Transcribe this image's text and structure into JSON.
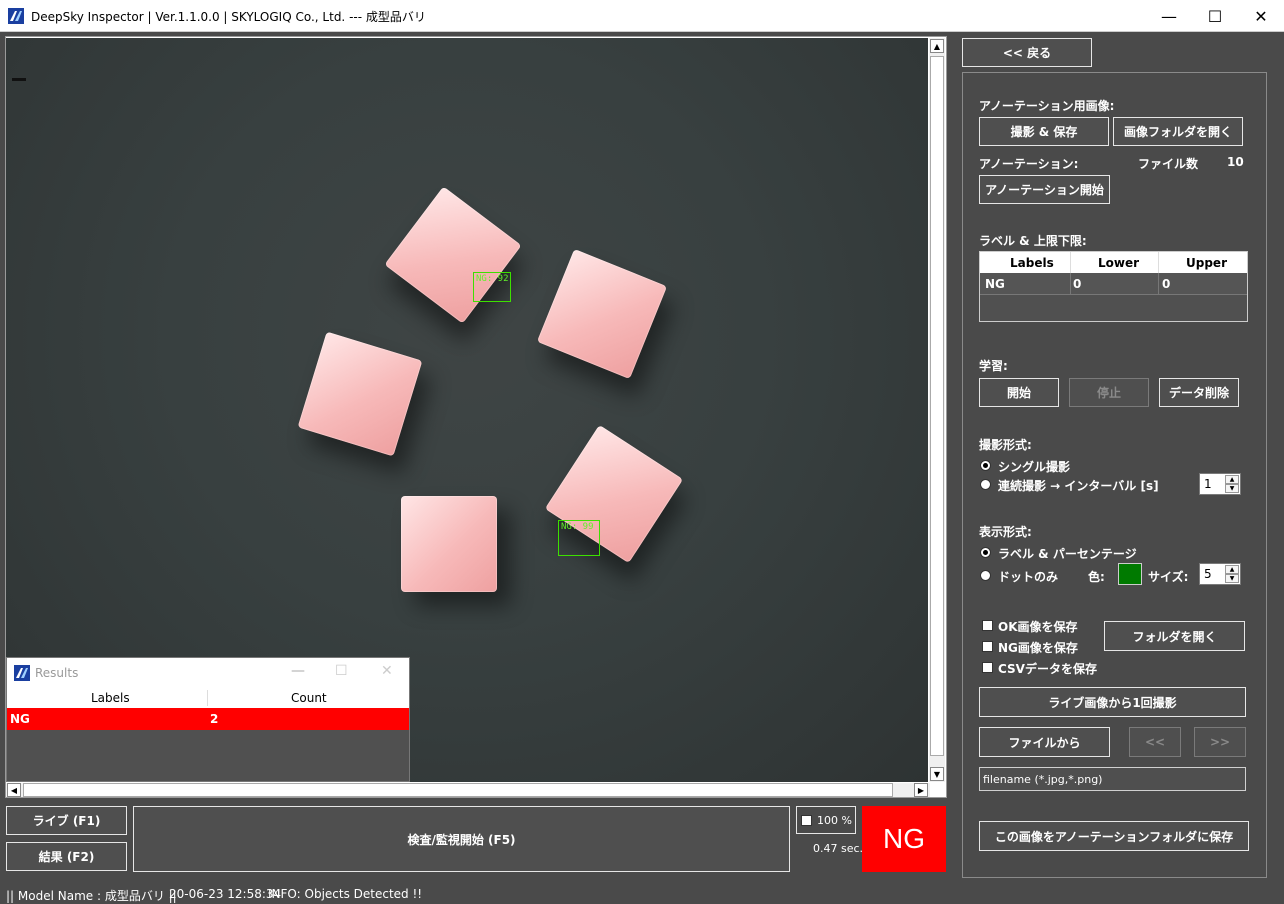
{
  "window": {
    "title": "DeepSky Inspector | Ver.1.1.0.0 | SKYLOGIQ Co., Ltd. --- 成型品バリ",
    "minimize": "—",
    "maximize": "☐",
    "close": "✕"
  },
  "viewer": {
    "detections": [
      {
        "label": "NG: 92"
      },
      {
        "label": "NG: 99"
      }
    ]
  },
  "results": {
    "title": "Results",
    "columns": [
      "Labels",
      "Count"
    ],
    "rows": [
      {
        "label": "NG",
        "count": "2"
      }
    ]
  },
  "controls": {
    "live_button": "ライブ (F1)",
    "result_button": "結果 (F2)",
    "inspect_button": "検査/監視開始 (F5)",
    "zoom_label": "100 %",
    "time": "0.47 sec.",
    "status": "NG",
    "status_color": "#ff0000"
  },
  "statusbar": {
    "model": "|| Model Name : 成型品バリ ||",
    "timestamp": "20-06-23 12:58:34",
    "info": "INFO:   Objects Detected !!"
  },
  "panel": {
    "back_button": "<< 戻る",
    "annotation_image_label": "アノーテーション用画像:",
    "capture_save_button": "撮影 & 保存",
    "open_image_folder_button": "画像フォルダを開く",
    "annotation_label": "アノーテーション:",
    "file_count_label": "ファイル数",
    "file_count": "10",
    "start_annotation_button": "アノーテーション開始",
    "label_limits_label": "ラベル & 上限下限:",
    "table": {
      "columns": [
        "Labels",
        "Lower",
        "Upper"
      ],
      "rows": [
        {
          "label": "NG",
          "lower": "0",
          "upper": "0"
        }
      ]
    },
    "learning_label": "学習:",
    "start_button": "開始",
    "stop_button": "停止",
    "delete_data_button": "データ削除",
    "capture_mode_label": "撮影形式:",
    "single_capture": "シングル撮影",
    "continuous_capture": "連続撮影 → インターバル [s]",
    "interval_value": "1",
    "display_mode_label": "表示形式:",
    "label_percentage": "ラベル & パーセンテージ",
    "dot_only": "ドットのみ",
    "color_label": "色:",
    "dot_color": "#007a00",
    "size_label": "サイズ:",
    "size_value": "5",
    "save_ok": "OK画像を保存",
    "save_ng": "NG画像を保存",
    "save_csv": "CSVデータを保存",
    "open_folder_button": "フォルダを開く",
    "capture_once_button": "ライブ画像から1回撮影",
    "from_file_button": "ファイルから",
    "prev_button": "<<",
    "next_button": ">>",
    "filename_placeholder": "filename (*.jpg,*.png)",
    "save_to_annotation_button": "この画像をアノーテーションフォルダに保存"
  }
}
